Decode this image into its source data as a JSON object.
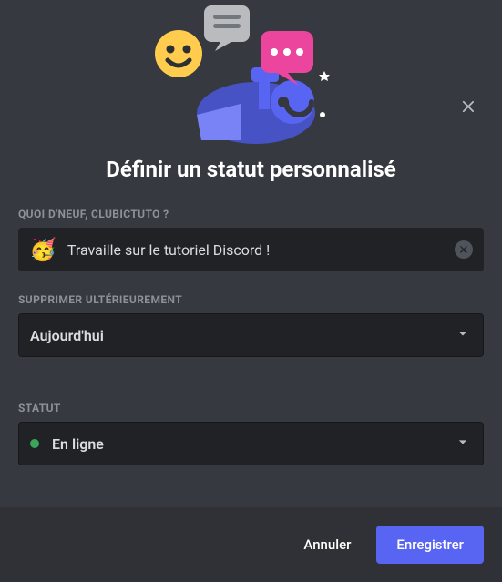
{
  "modal": {
    "title": "Définir un statut personnalisé",
    "fields": {
      "activity": {
        "label": "QUOI D'NEUF, CLUBICTUTO ?",
        "emoji": "🥳",
        "value": "Travaille sur le tutoriel Discord !"
      },
      "clearAfter": {
        "label": "SUPPRIMER ULTÉRIEUREMENT",
        "value": "Aujourd'hui"
      },
      "status": {
        "label": "STATUT",
        "value": "En ligne"
      }
    },
    "buttons": {
      "cancel": "Annuler",
      "save": "Enregistrer"
    }
  }
}
